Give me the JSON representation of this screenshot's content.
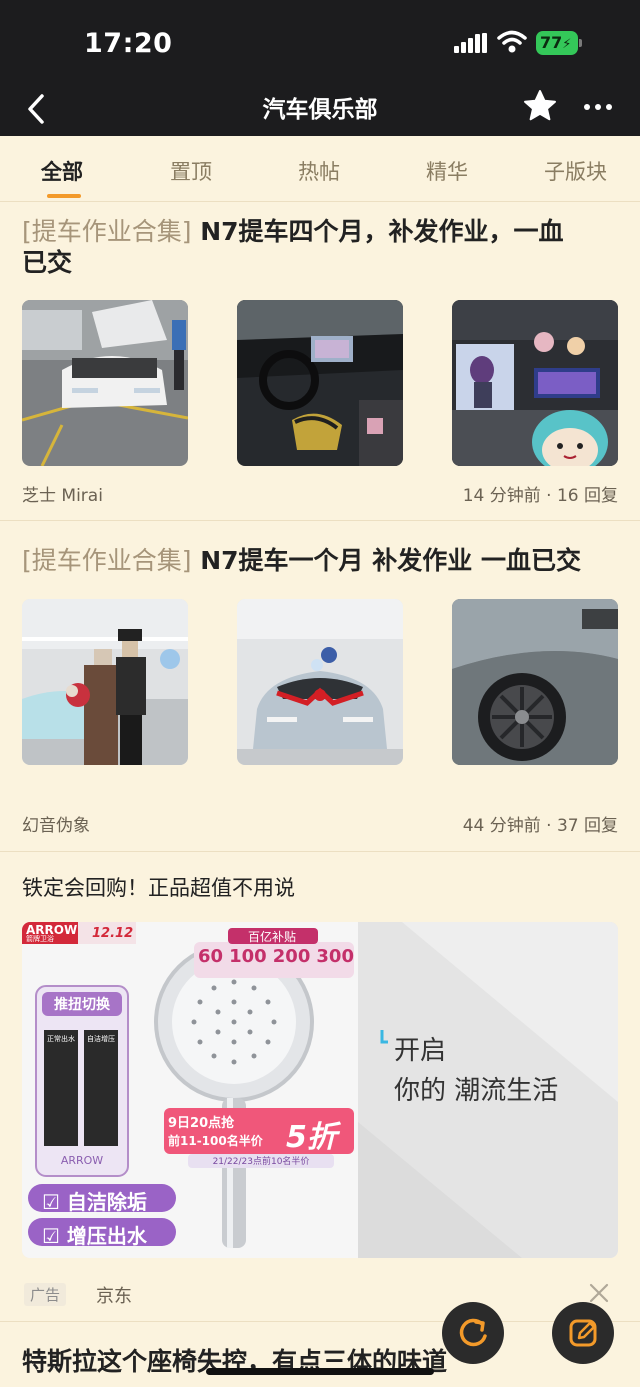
{
  "status_bar": {
    "time": "17:20",
    "battery": "77"
  },
  "nav": {
    "title": "汽车俱乐部"
  },
  "tabs": [
    {
      "label": "全部"
    },
    {
      "label": "置顶"
    },
    {
      "label": "热帖"
    },
    {
      "label": "精华"
    },
    {
      "label": "子版块"
    }
  ],
  "posts": [
    {
      "tag": "[提车作业合集]",
      "title_line1": " N7提车四个月，补发作业，一血",
      "title_line2": "已交",
      "author": "芝士 Mirai",
      "meta": "14 分钟前 · 16 回复"
    },
    {
      "tag": "[提车作业合集]",
      "title_line1": " N7提车一个月 补发作业 一血已交",
      "author": "幻音伪象",
      "meta": "44 分钟前 · 37 回复"
    }
  ],
  "ad": {
    "title": "铁定会回购！正品超值不用说",
    "brand": "ARROW",
    "brand_sub": "箭牌卫浴",
    "promo_date": "12.12",
    "subsidy": "百亿补贴",
    "coupons": [
      "60",
      "100",
      "200",
      "300"
    ],
    "feature_badge": "推扭切换",
    "mode_left": "正常出水",
    "mode_right": "自洁增压",
    "feature1": "自洁除垢",
    "feature2": "增压出水",
    "sale_line1": "9日20点抢",
    "sale_line2": "前11-100名半价",
    "sale_discount": "5折",
    "sale_line3": "21/22/23点前10名半价",
    "slogan1": "开启",
    "slogan2": "你的 潮流生活",
    "label": "广告",
    "source": "京东"
  },
  "next_post": {
    "title": "特斯拉这个座椅失控，有点三体的味道"
  },
  "colors": {
    "accent": "#f39a2a",
    "background": "#fbf3de",
    "header": "#1c1c1e"
  }
}
